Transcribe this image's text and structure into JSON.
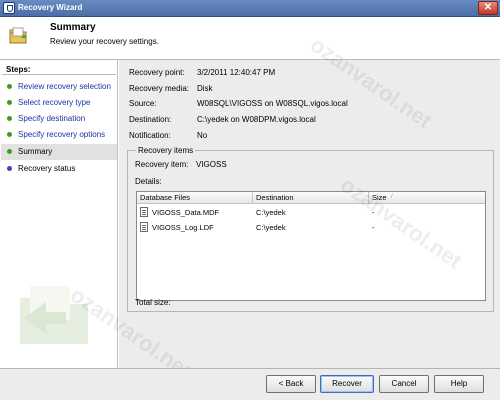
{
  "window": {
    "title": "Recovery Wizard",
    "close_glyph": "✕"
  },
  "header": {
    "title": "Summary",
    "subtitle": "Review your recovery settings."
  },
  "sidebar": {
    "label": "Steps:",
    "items": [
      {
        "label": "Review recovery selection",
        "state": "done",
        "dot_color": "#3aa01f"
      },
      {
        "label": "Select recovery type",
        "state": "done",
        "dot_color": "#3aa01f"
      },
      {
        "label": "Specify destination",
        "state": "done",
        "dot_color": "#3aa01f"
      },
      {
        "label": "Specify recovery options",
        "state": "done",
        "dot_color": "#3aa01f"
      },
      {
        "label": "Summary",
        "state": "current",
        "dot_color": "#3aa01f"
      },
      {
        "label": "Recovery status",
        "state": "pending",
        "dot_color": "#4b3fb0"
      }
    ]
  },
  "summary": {
    "recovery_point": {
      "label": "Recovery point:",
      "value": "3/2/2011 12:40:47 PM"
    },
    "recovery_media": {
      "label": "Recovery media:",
      "value": "Disk"
    },
    "source": {
      "label": "Source:",
      "value": "W08SQL\\VIGOSS on W08SQL.vigos.local"
    },
    "destination": {
      "label": "Destination:",
      "value": "C:\\yedek on W08DPM.vigos.local"
    },
    "notification": {
      "label": "Notification:",
      "value": "No"
    }
  },
  "recovery_items": {
    "legend": "Recovery items",
    "item_label": "Recovery item:",
    "item_value": "VIGOSS",
    "details_label": "Details:",
    "columns": [
      "Database Files",
      "Destination",
      "Size"
    ],
    "sort_glyph": "/",
    "rows": [
      {
        "file": "VIGOSS_Data.MDF",
        "destination": "C:\\yedek",
        "size": "-"
      },
      {
        "file": "VIGOSS_Log.LDF",
        "destination": "C:\\yedek",
        "size": "-"
      }
    ],
    "total_size_label": "Total size:"
  },
  "buttons": {
    "back": "< Back",
    "recover": "Recover",
    "cancel": "Cancel",
    "help": "Help"
  },
  "watermark": "ozanvarol.net"
}
